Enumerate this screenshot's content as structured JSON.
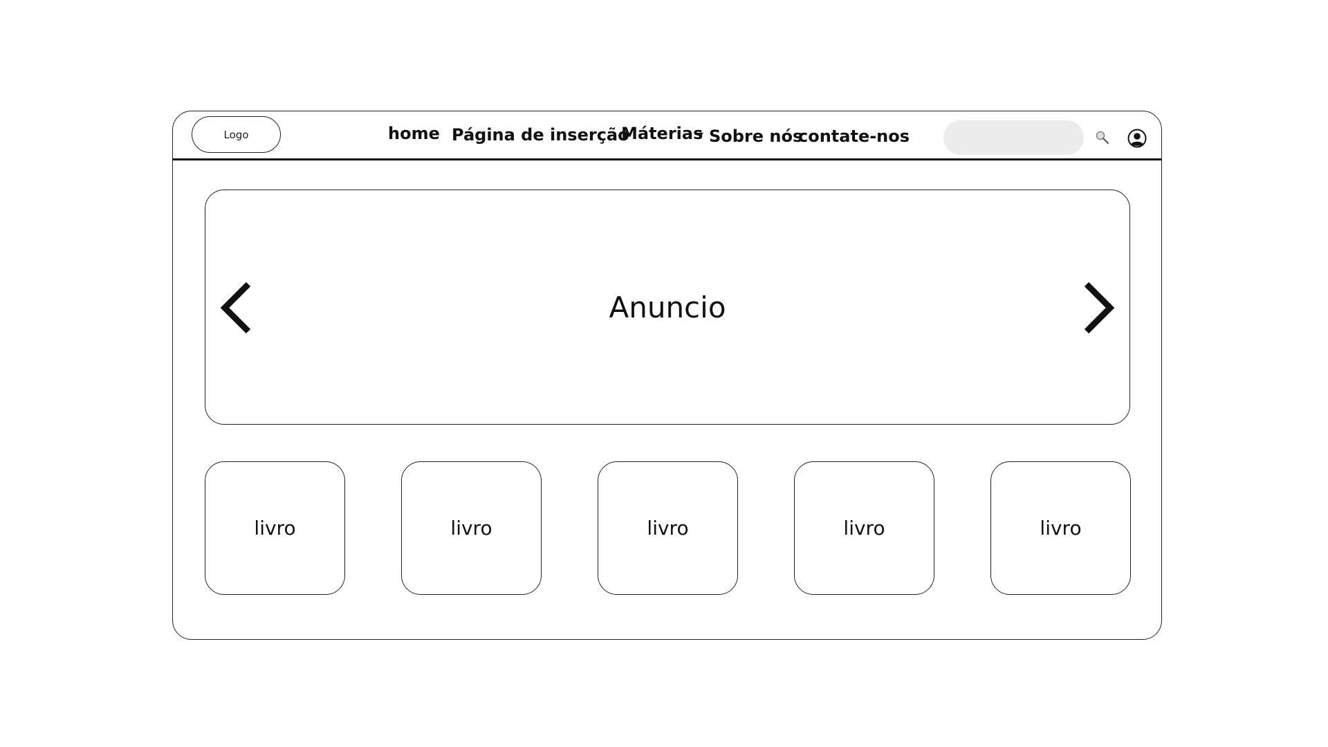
{
  "navbar": {
    "logo_label": "Logo",
    "links": {
      "home": "home",
      "insert_page": "Página de inserção",
      "subjects": "Máterias",
      "about": "Sobre nós",
      "contact": "contate-nos"
    },
    "search": {
      "placeholder": ""
    },
    "icons": {
      "search": "search-icon",
      "user": "user-icon",
      "subjects_dropdown": "caret-down-icon"
    }
  },
  "banner": {
    "title": "Anuncio",
    "icons": {
      "prev": "chevron-left-icon",
      "next": "chevron-right-icon"
    }
  },
  "books": [
    {
      "label": "livro"
    },
    {
      "label": "livro"
    },
    {
      "label": "livro"
    },
    {
      "label": "livro"
    },
    {
      "label": "livro"
    }
  ],
  "colors": {
    "stroke": "#111111",
    "search_fill": "#ececec",
    "background": "#ffffff"
  }
}
